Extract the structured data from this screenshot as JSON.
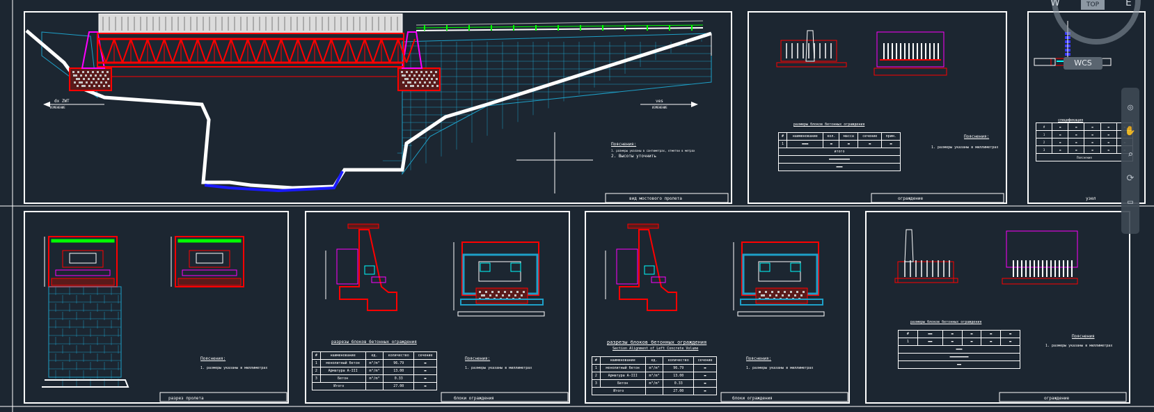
{
  "sheets": {
    "s1": {
      "arrow_left": "dx ZWT",
      "arrow_left_sub": "ИЗМЕНЕНИЕ",
      "arrow_right": "ves",
      "arrow_right_sub": "ИЗМЕНЕНИЕ",
      "notes_title": "Пояснения:",
      "notes_line1": "1. размеры указаны в сантиметрах, отметки в метрах",
      "notes_line2": "2. Высоты уточнить",
      "titleblock": "вид мостового пролета"
    },
    "s2": {
      "table_title": "размеры блоков бетонных ограждения",
      "table_headers": [
        "#",
        "наименование",
        "кол.",
        "масса",
        "сечение",
        "прим."
      ],
      "row_label": "итого",
      "notes_title": "Пояснения:",
      "notes_line1": "1. размеры указаны в миллиметрах",
      "titleblock": "ограждение"
    },
    "s3": {
      "table_title": "спецификация",
      "notes_line": "Пояснения",
      "titleblock": "узел"
    },
    "s4": {
      "notes_title": "Пояснения:",
      "notes_line1": "1. размеры указаны в миллиметрах",
      "titleblock": "разрез пролета"
    },
    "s5": {
      "caption": "разрезы блоков бетонных ограждения",
      "caption_sub": "",
      "notes_title": "Пояснения:",
      "notes_line1": "1. размеры указаны в миллиметрах",
      "table_headers": [
        "#",
        "наименование",
        "ед.",
        "количество",
        "сечение"
      ],
      "rows": [
        {
          "n": "1",
          "name": "монолитный бетон",
          "unit": "m³/m³",
          "qty": "96.79"
        },
        {
          "n": "2",
          "name": "Арматура A-III",
          "unit": "m³/m³",
          "qty": "13.00"
        },
        {
          "n": "3",
          "name": "Бетон",
          "unit": "m³/m³",
          "qty": "0.33"
        }
      ],
      "total_label": "Итого",
      "total_value": "27.00",
      "titleblock": "блоки ограждения"
    },
    "s6": {
      "caption": "разрезы блоков бетонных ограждения",
      "caption_sub": "Section Alignment of Left Concrete Volume",
      "notes_title": "Пояснения:",
      "notes_line1": "1. размеры указаны в миллиметрах",
      "table_headers": [
        "#",
        "наименование",
        "ед.",
        "количество",
        "сечение"
      ],
      "rows": [
        {
          "n": "1",
          "name": "монолитный бетон",
          "unit": "m³/m³",
          "qty": "96.79"
        },
        {
          "n": "2",
          "name": "Арматура A-III",
          "unit": "m³/m³",
          "qty": "13.00"
        },
        {
          "n": "3",
          "name": "Бетон",
          "unit": "m³/m³",
          "qty": "0.33"
        }
      ],
      "total_label": "Итого",
      "total_value": "27.00",
      "titleblock": "блоки ограждения"
    },
    "s7": {
      "table_title": "размеры блоков бетонных ограждения",
      "notes_title": "Пояснения",
      "notes_line1": "1. размеры указаны в миллиметрах",
      "titleblock": "ограждение"
    }
  },
  "viewcube": {
    "top_label": "TOP",
    "letters": [
      "W",
      "E"
    ]
  },
  "wcs_label": "WCS",
  "colors": {
    "background": "#1c2631",
    "frame": "#ffffff",
    "structure": "#ff0000",
    "accent_magenta": "#ff00ff",
    "accent_cyan": "#00ffff",
    "masonry": "#1ea0c8",
    "water": "#1a1aff"
  },
  "icons": [
    "zoom-icon",
    "pan-icon",
    "orbit-icon",
    "showmotion-icon"
  ]
}
